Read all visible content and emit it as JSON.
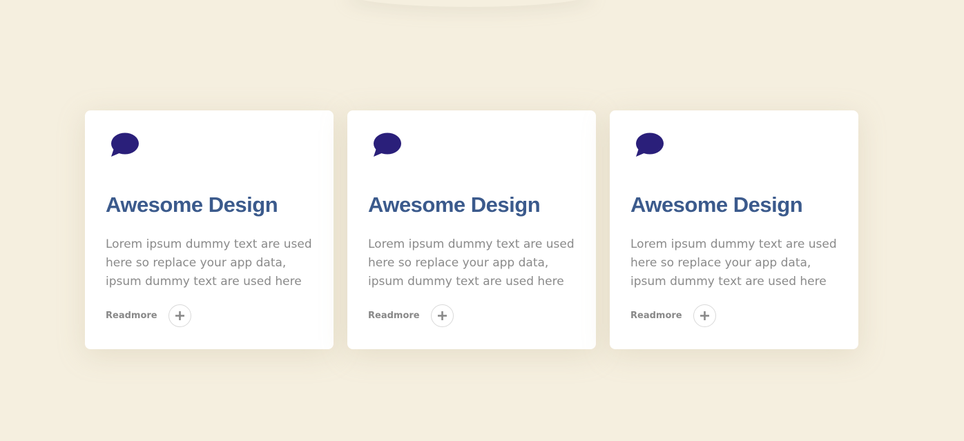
{
  "colors": {
    "background": "#f5efdf",
    "card": "#ffffff",
    "title": "#3b5a8c",
    "icon": "#2a1f7a",
    "body_text": "#8a8a8a",
    "link": "#888888"
  },
  "cards": [
    {
      "icon": "chat-bubble-icon",
      "title": "Awesome Design",
      "text": "Lorem ipsum dummy text are used here so replace your app data, ipsum dummy text are used here so",
      "link_label": "Readmore",
      "action_icon": "plus-icon"
    },
    {
      "icon": "chat-bubble-icon",
      "title": "Awesome Design",
      "text": "Lorem ipsum dummy text are used here so replace your app data, ipsum dummy text are used here so",
      "link_label": "Readmore",
      "action_icon": "plus-icon"
    },
    {
      "icon": "chat-bubble-icon",
      "title": "Awesome Design",
      "text": "Lorem ipsum dummy text are used here so replace your app data, ipsum dummy text are used here so",
      "link_label": "Readmore",
      "action_icon": "plus-icon"
    }
  ]
}
